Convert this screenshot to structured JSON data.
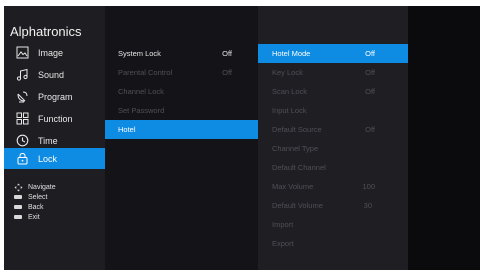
{
  "brand": "Alphatronics",
  "main_menu": [
    {
      "label": "Image",
      "icon": "image-icon"
    },
    {
      "label": "Sound",
      "icon": "music-note-icon"
    },
    {
      "label": "Program",
      "icon": "satellite-dish-icon"
    },
    {
      "label": "Function",
      "icon": "grid-icon"
    },
    {
      "label": "Time",
      "icon": "clock-icon"
    },
    {
      "label": "Lock",
      "icon": "padlock-icon",
      "selected": true
    }
  ],
  "hints": [
    {
      "icon": "dpad-icon",
      "label": "Navigate"
    },
    {
      "icon": "ok-key-icon",
      "label": "Select"
    },
    {
      "icon": "back-key-icon",
      "label": "Back"
    },
    {
      "icon": "exit-key-icon",
      "label": "Exit"
    }
  ],
  "lock_menu": [
    {
      "label": "System Lock",
      "value": "Off"
    },
    {
      "label": "Parental Control",
      "value": "Off",
      "disabled": true
    },
    {
      "label": "Channel Lock",
      "value": "",
      "disabled": true
    },
    {
      "label": "Set Password",
      "value": "",
      "disabled": true
    },
    {
      "label": "Hotel",
      "value": "",
      "selected": true
    }
  ],
  "hotel_menu": [
    {
      "label": "Hotel Mode",
      "value": "Off",
      "selected": true
    },
    {
      "label": "Key Lock",
      "value": "Off"
    },
    {
      "label": "Scan Lock",
      "value": "Off"
    },
    {
      "label": "Input Lock",
      "value": ""
    },
    {
      "label": "Default Source",
      "value": "Off"
    },
    {
      "label": "Channel Type",
      "value": ""
    },
    {
      "label": "Default Channel",
      "value": ""
    },
    {
      "label": "Max Volume",
      "value": "100"
    },
    {
      "label": "Default Volume",
      "value": "30"
    },
    {
      "label": "Import",
      "value": ""
    },
    {
      "label": "Export",
      "value": ""
    }
  ],
  "colors": {
    "accent": "#0e8be2",
    "disabled_text": "#4f4f55"
  }
}
